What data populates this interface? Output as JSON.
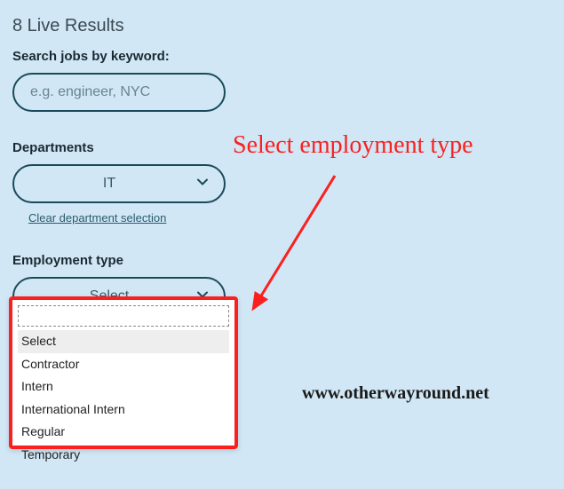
{
  "header": {
    "results_text": "8 Live Results"
  },
  "search": {
    "label": "Search jobs by keyword:",
    "placeholder": "e.g. engineer, NYC",
    "value": ""
  },
  "departments": {
    "label": "Departments",
    "selected": "IT",
    "clear_text": "Clear department selection"
  },
  "employment": {
    "label": "Employment type",
    "selected": "Select",
    "dropdown_search_value": "",
    "options": [
      "Select",
      "Contractor",
      "Intern",
      "International Intern",
      "Regular",
      "Temporary"
    ]
  },
  "annotation": {
    "text": "Select employment type",
    "website": "www.otherwayround.net"
  }
}
